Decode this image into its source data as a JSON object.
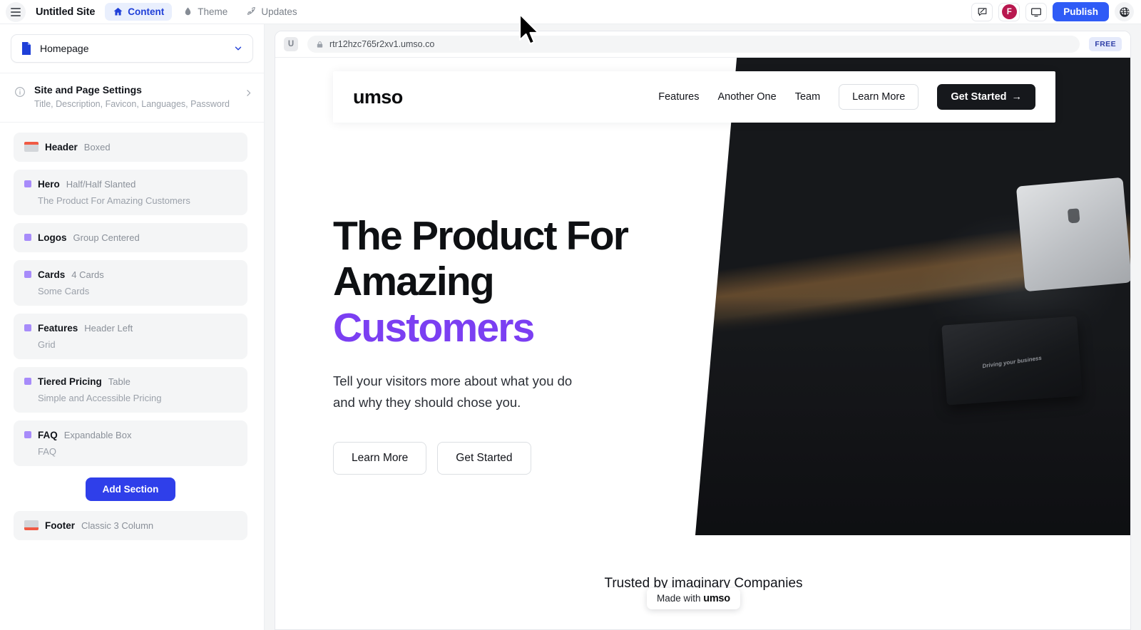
{
  "topbar": {
    "menu_icon": "hamburger-icon",
    "site_title": "Untitled Site",
    "tabs": [
      {
        "label": "Content",
        "icon": "home-icon",
        "active": true
      },
      {
        "label": "Theme",
        "icon": "droplet-icon",
        "active": false
      },
      {
        "label": "Updates",
        "icon": "rocket-icon",
        "active": false
      }
    ],
    "actions": {
      "feedback_icon": "feedback-message-icon",
      "avatar_initial": "F",
      "avatar_color": "#b8184f",
      "preview_icon": "monitor-icon",
      "publish_label": "Publish",
      "publish_color": "#2f5bf6",
      "globe_icon": "globe-icon"
    }
  },
  "sidebar": {
    "page_selector": {
      "label": "Homepage",
      "icon": "document-icon",
      "chevron": "chevron-down-icon"
    },
    "settings": {
      "icon": "info-circle-icon",
      "title": "Site and Page Settings",
      "subtitle": "Title, Description, Favicon, Languages, Password",
      "chevron": "chevron-right-icon"
    },
    "sections": [
      {
        "name": "Header",
        "variant": "Boxed",
        "subtitle": "",
        "icon": "header-block-icon"
      },
      {
        "name": "Hero",
        "variant": "Half/Half Slanted",
        "subtitle": "The Product For Amazing Customers",
        "icon": "section-dot-icon"
      },
      {
        "name": "Logos",
        "variant": "Group Centered",
        "subtitle": "",
        "icon": "section-dot-icon"
      },
      {
        "name": "Cards",
        "variant": "4 Cards",
        "subtitle": "Some Cards",
        "icon": "section-dot-icon"
      },
      {
        "name": "Features",
        "variant": "Header Left",
        "subtitle": "Grid",
        "icon": "section-dot-icon"
      },
      {
        "name": "Tiered Pricing",
        "variant": "Table",
        "subtitle": "Simple and Accessible Pricing",
        "icon": "section-dot-icon"
      },
      {
        "name": "FAQ",
        "variant": "Expandable Box",
        "subtitle": "FAQ",
        "icon": "section-dot-icon"
      }
    ],
    "add_section_label": "Add Section",
    "add_section_color": "#2f3fea",
    "footer_section": {
      "name": "Footer",
      "variant": "Classic 3 Column",
      "icon": "footer-block-icon"
    }
  },
  "browser": {
    "favicon_letter": "U",
    "lock_icon": "lock-icon",
    "url": "rtr12hzc765r2xv1.umso.co",
    "plan_badge": "FREE"
  },
  "site": {
    "logo": "umso",
    "nav_links": [
      "Features",
      "Another One",
      "Team"
    ],
    "nav_ghost_button": "Learn More",
    "nav_cta_button": "Get Started",
    "nav_cta_arrow": "→",
    "hero": {
      "headline_line1": "The Product For",
      "headline_line2": "Amazing",
      "headline_accent": "Customers",
      "accent_color": "#7b3ff2",
      "paragraph": "Tell your visitors more about what you do and why they should chose you.",
      "button_primary": "Learn More",
      "button_secondary": "Get Started",
      "image_caption": "Driving your business"
    },
    "trusted_text": "Trusted by imaginary Companies",
    "made_with_prefix": "Made with ",
    "made_with_brand": "umso"
  }
}
